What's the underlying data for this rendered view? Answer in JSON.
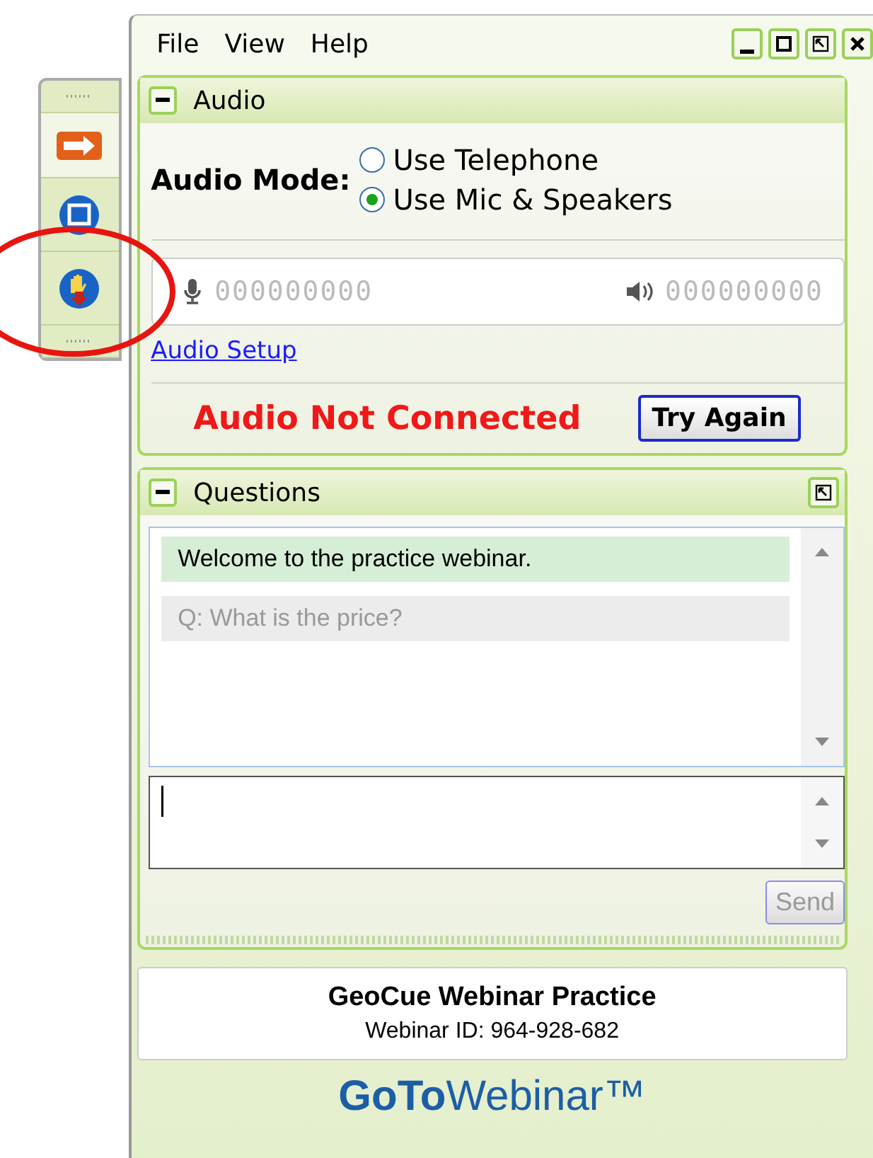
{
  "menu": [
    "File",
    "View",
    "Help"
  ],
  "window_controls": [
    {
      "kind": "minimize"
    },
    {
      "kind": "maximize"
    },
    {
      "kind": "restore"
    },
    {
      "kind": "close"
    }
  ],
  "toolbar": [
    {
      "kind": "arrow"
    },
    {
      "kind": "screen"
    },
    {
      "kind": "hand"
    }
  ],
  "audio": {
    "title": "Audio",
    "mode_label": "Audio Mode:",
    "options": [
      {
        "label": "Use Telephone",
        "selected": false
      },
      {
        "label": "Use Mic & Speakers",
        "selected": true
      }
    ],
    "mic_reading": "000000000",
    "speaker_reading": "000000000",
    "setup_link": "Audio Setup",
    "status": "Audio Not Connected",
    "retry_button": "Try Again"
  },
  "questions": {
    "title": "Questions",
    "messages": [
      {
        "kind": "announcement",
        "text": "Welcome to the practice webinar."
      },
      {
        "kind": "question",
        "text": "Q: What is the price?"
      }
    ],
    "send_button": {
      "label": "Send",
      "disabled": true
    }
  },
  "webinar": {
    "name": "GeoCue Webinar Practice",
    "id_line": "Webinar ID: 964-928-682"
  },
  "logo": "**GoTo**Webinar™"
}
